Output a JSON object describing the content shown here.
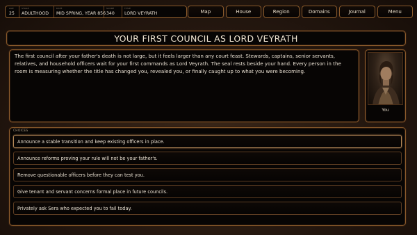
{
  "status": {
    "age": {
      "caption": "AGE",
      "value": "25"
    },
    "stage": {
      "caption": "STAGE",
      "value": "ADULTHOOD"
    },
    "date": {
      "caption": "DATE",
      "value": "MID SPRING, YEAR 856"
    },
    "score": {
      "caption": "SCORE",
      "value": "340"
    },
    "title": {
      "caption": "TITLE",
      "value": "LORD VEYRATH"
    }
  },
  "nav": [
    "Map",
    "House",
    "Region",
    "Domains",
    "Journal",
    "Menu"
  ],
  "scene": {
    "title": "YOUR FIRST COUNCIL AS LORD VEYRATH",
    "text": "The first council after your father's death is not large, but it feels larger than any court feast. Stewards, captains, senior servants, relatives, and household officers wait for your first commands as Lord Veyrath. The seal rests beside your hand. Every person in the room is measuring whether the title has changed you, revealed you, or finally caught up to what you were becoming."
  },
  "portrait": {
    "label": "You"
  },
  "choices": {
    "caption": "CHOICES",
    "items": [
      "Announce a stable transition and keep existing officers in place.",
      "Announce reforms proving your rule will not be your father's.",
      "Remove questionable officers before they can test you.",
      "Give tenant and servant concerns formal place in future councils.",
      "Privately ask Sera who expected you to fail today."
    ]
  }
}
